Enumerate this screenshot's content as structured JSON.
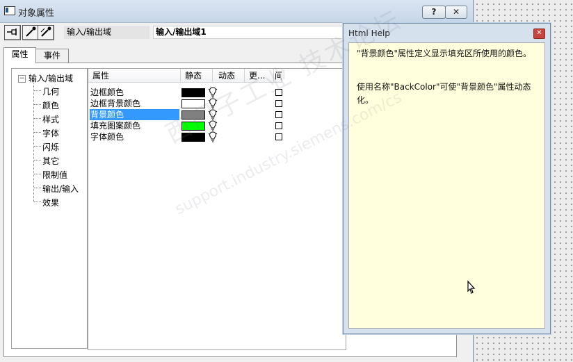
{
  "window": {
    "title": "对象属性",
    "help_button": "?",
    "close_button": "✕"
  },
  "toolbar": {
    "pin_icon": "pin-icon",
    "pipette_icon": "pipette-icon",
    "object_type": "输入/输出域",
    "object_name": "输入/输出域1"
  },
  "tabs": [
    {
      "label": "属性"
    },
    {
      "label": "事件"
    }
  ],
  "tree": {
    "root": "输入/输出域",
    "expander": "−",
    "children": [
      "几何",
      "颜色",
      "样式",
      "字体",
      "闪烁",
      "其它",
      "限制值",
      "输出/输入",
      "效果"
    ]
  },
  "grid": {
    "headers": {
      "property": "属性",
      "static": "静态",
      "dynamic": "动态",
      "more": "更...",
      "indirect": "间."
    },
    "rows": [
      {
        "label": "边框颜色",
        "color": "#000000"
      },
      {
        "label": "边框背景颜色",
        "color": "#ffffff"
      },
      {
        "label": "背景颜色",
        "color": "#808080",
        "selected": true
      },
      {
        "label": "填充图案颜色",
        "color": "#00ff00"
      },
      {
        "label": "字体颜色",
        "color": "#000000"
      }
    ]
  },
  "help": {
    "title": "Html Help",
    "close": "✕",
    "para1": "\"背景颜色\"属性定义显示填充区所使用的颜色。",
    "para2": "使用名称\"BackColor\"可使\"背景颜色\"属性动态化。"
  },
  "watermark": {
    "line1": "西门子工业 技术论坛",
    "line2": "support.industry.siemens.com/cs"
  },
  "colors": {
    "selection": "#3399ff",
    "help_background": "#ffffdd",
    "close_red": "#c9443c"
  }
}
